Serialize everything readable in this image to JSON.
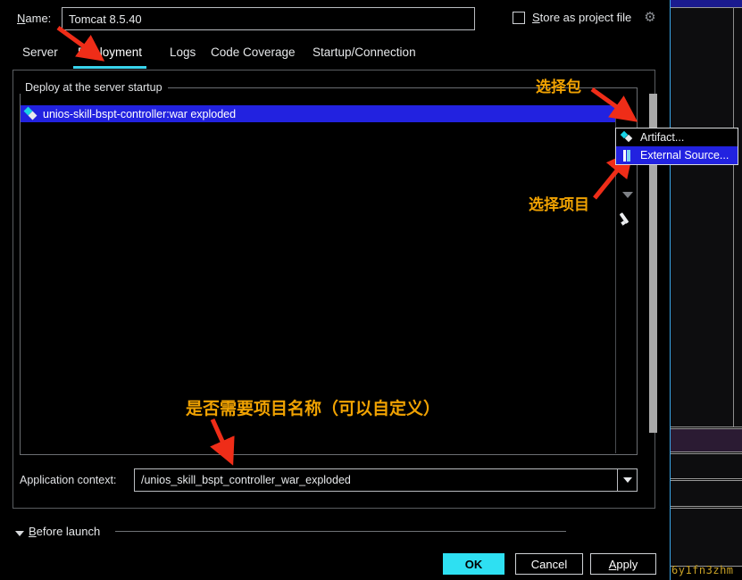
{
  "dialog": {
    "name_label": "Name:",
    "name_label_mnemonic": "N",
    "name_value": "Tomcat 8.5.40",
    "store_as_project_file": {
      "label": "Store as project file",
      "checked": false,
      "gear_icon": "gear-icon"
    },
    "tabs": [
      {
        "label": "Server",
        "active": false
      },
      {
        "label": "Deployment",
        "active": true
      },
      {
        "label": "Logs",
        "active": false
      },
      {
        "label": "Code Coverage",
        "active": false
      },
      {
        "label": "Startup/Connection",
        "active": false
      }
    ],
    "active_tab_underline_color": "#39d3ec",
    "deploy_group": {
      "label": "Deploy at the server startup",
      "items": [
        {
          "label": "unios-skill-bspt-controller:war exploded",
          "icon": "artifact-icon",
          "selected": true,
          "selection_color": "#2222e0"
        }
      ],
      "toolbar": [
        {
          "name": "add-button",
          "glyph": "+"
        },
        {
          "name": "remove-button",
          "glyph": "−"
        },
        {
          "name": "move-down-button",
          "glyph": "caret-down-icon"
        },
        {
          "name": "edit-button",
          "glyph": "pencil-icon"
        }
      ]
    },
    "add_menu": {
      "visible": true,
      "items": [
        {
          "label": "Artifact...",
          "icon": "artifact-icon",
          "highlighted": false
        },
        {
          "label": "External Source...",
          "icon": "external-source-icon",
          "highlighted": true
        }
      ],
      "highlight_color": "#2222e0"
    },
    "application_context": {
      "label": "Application context:",
      "value": "/unios_skill_bspt_controller_war_exploded"
    },
    "before_launch": {
      "label": "Before launch",
      "mnemonic": "B",
      "expanded": true
    },
    "buttons": [
      {
        "name": "ok-button",
        "label": "OK",
        "primary": true,
        "color": "#2ee0f2"
      },
      {
        "name": "cancel-button",
        "label": "Cancel",
        "primary": false
      },
      {
        "name": "apply-button",
        "label": "Apply",
        "primary": false,
        "mnemonic": "A"
      }
    ]
  },
  "annotations": {
    "color": "#f0a202",
    "arrow_color": "#ef2d18",
    "notes": [
      {
        "text": "选择包"
      },
      {
        "text": "选择项目"
      },
      {
        "text": "是否需要项目名称（可以自定义）"
      }
    ]
  },
  "background_editor": {
    "bottom_code_text": "6y1fn3zhm"
  }
}
